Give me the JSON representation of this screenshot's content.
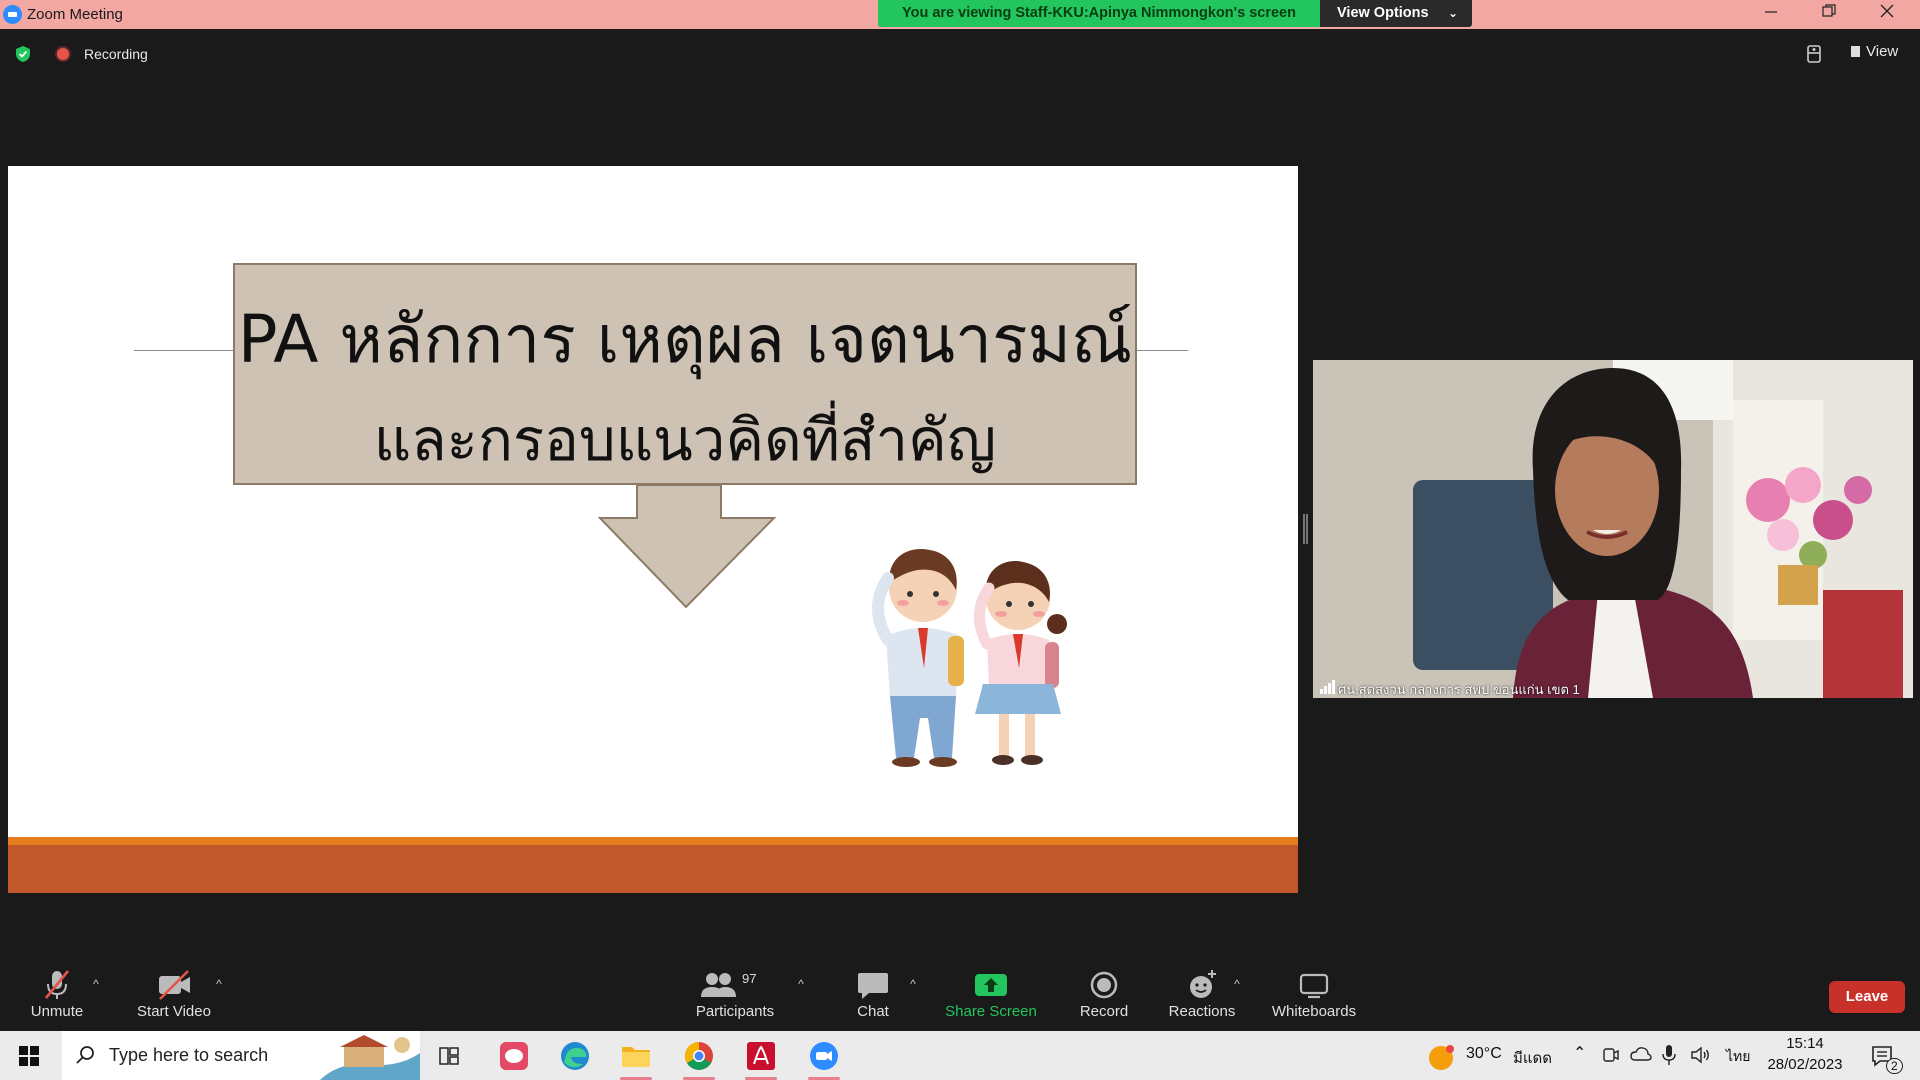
{
  "window": {
    "title": "Zoom Meeting",
    "viewing_banner": "You are viewing Staff-KKU:Apinya Nimmongkon's screen",
    "view_options_label": "View Options"
  },
  "meeting_bar": {
    "recording_label": "Recording",
    "view_label": "View"
  },
  "slide": {
    "title_line1": "PA หลักการ เหตุผล เจตนารมณ์",
    "title_line2": "และกรอบแนวคิดที่สำคัญ",
    "colors": {
      "box": "#cdc2b3",
      "band_orange": "#e57c1e",
      "band_rust": "#c1582c"
    }
  },
  "video": {
    "participant_name": "ศน.สุดสงวน กลางการ สพป.ขอนแก่น เขต 1"
  },
  "toolbar": {
    "unmute_label": "Unmute",
    "start_video_label": "Start Video",
    "participants_label": "Participants",
    "participants_count": "97",
    "chat_label": "Chat",
    "share_screen_label": "Share Screen",
    "record_label": "Record",
    "reactions_label": "Reactions",
    "whiteboards_label": "Whiteboards",
    "leave_label": "Leave"
  },
  "taskbar": {
    "search_placeholder": "Type here to search",
    "apps": [
      "task-view-icon",
      "line-icon",
      "edge-icon",
      "file-explorer-icon",
      "chrome-icon",
      "acrobat-icon",
      "zoom-icon"
    ],
    "weather_temp": "30°C",
    "weather_desc": "มีแดด",
    "language": "ไทย",
    "time": "15:14",
    "date": "28/02/2023",
    "notification_count": "2"
  }
}
